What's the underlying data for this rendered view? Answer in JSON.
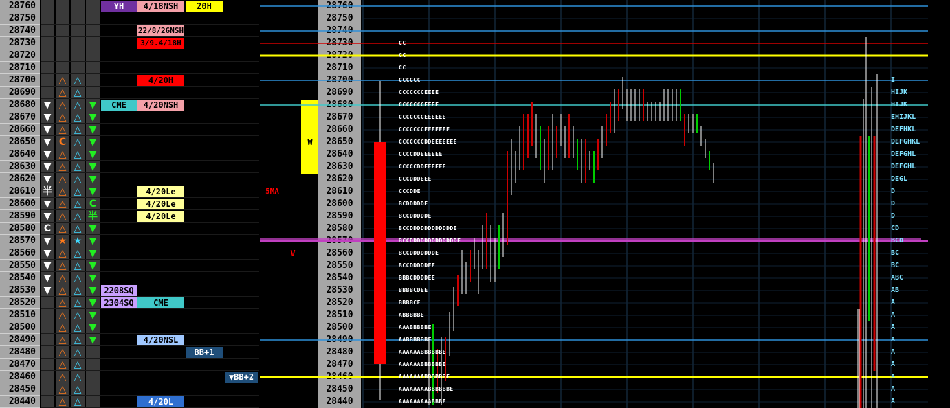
{
  "price_ladder": [
    "28760",
    "28750",
    "28740",
    "28730",
    "28720",
    "28710",
    "28700",
    "28690",
    "28680",
    "28670",
    "28660",
    "28650",
    "28640",
    "28630",
    "28620",
    "28610",
    "28600",
    "28590",
    "28580",
    "28570",
    "28560",
    "28550",
    "28540",
    "28530",
    "28520",
    "28510",
    "28500",
    "28490",
    "28480",
    "28470",
    "28460",
    "28450",
    "28440"
  ],
  "signal_rows": [
    {
      "price": "28680",
      "cols": [
        "tri-down",
        "tri-up-o",
        "tri-up-c",
        "tri-down-g"
      ]
    },
    {
      "price": "28670",
      "cols": [
        "tri-down",
        "tri-up-o",
        "tri-up-c",
        "tri-down-g"
      ]
    },
    {
      "price": "28660",
      "cols": [
        "tri-down",
        "tri-up-o",
        "tri-up-c",
        "tri-down-g"
      ]
    },
    {
      "price": "28650",
      "cols": [
        "tri-down",
        "C-o",
        "tri-up-c",
        "tri-down-g"
      ]
    },
    {
      "price": "28640",
      "cols": [
        "tri-down",
        "tri-up-o",
        "tri-up-c",
        "tri-down-g"
      ]
    },
    {
      "price": "28630",
      "cols": [
        "tri-down",
        "tri-up-o",
        "tri-up-c",
        "tri-down-g"
      ]
    },
    {
      "price": "28620",
      "cols": [
        "tri-down",
        "tri-up-o",
        "tri-up-c",
        "tri-down-g"
      ]
    },
    {
      "price": "28610",
      "cols": [
        "half-w",
        "tri-up-o",
        "tri-up-c",
        "tri-down-g"
      ]
    },
    {
      "price": "28600",
      "cols": [
        "tri-down",
        "tri-up-o",
        "tri-up-c",
        "C-g"
      ]
    },
    {
      "price": "28590",
      "cols": [
        "tri-down",
        "tri-up-o",
        "tri-up-c",
        "half-g"
      ]
    },
    {
      "price": "28580",
      "cols": [
        "C-w",
        "tri-up-o",
        "tri-up-c",
        "tri-down-g"
      ]
    },
    {
      "price": "28570",
      "cols": [
        "tri-down",
        "star-o",
        "star-c",
        "tri-down-g"
      ]
    },
    {
      "price": "28560",
      "cols": [
        "tri-down",
        "tri-up-o",
        "tri-up-c",
        "tri-down-g"
      ]
    },
    {
      "price": "28550",
      "cols": [
        "tri-down",
        "tri-up-o",
        "tri-up-c",
        "tri-down-g"
      ]
    },
    {
      "price": "28540",
      "cols": [
        "tri-down",
        "tri-up-o",
        "tri-up-c",
        "tri-down-g"
      ]
    },
    {
      "price": "28530",
      "cols": [
        "tri-down",
        "tri-up-o",
        "tri-up-c",
        "tri-down-g"
      ]
    },
    {
      "price": "28520",
      "cols": [
        "",
        "tri-up-o",
        "tri-up-c",
        "tri-down-g"
      ]
    },
    {
      "price": "28510",
      "cols": [
        "",
        "tri-up-o",
        "tri-up-c",
        "tri-down-g"
      ]
    },
    {
      "price": "28500",
      "cols": [
        "",
        "tri-up-o",
        "tri-up-c",
        "tri-down-g"
      ]
    },
    {
      "price": "28490",
      "cols": [
        "",
        "tri-up-o",
        "tri-up-c",
        "tri-down-g"
      ]
    },
    {
      "price": "28480",
      "cols": [
        "",
        "tri-up-o",
        "tri-up-c",
        ""
      ]
    },
    {
      "price": "28470",
      "cols": [
        "",
        "tri-up-o",
        "tri-up-c",
        ""
      ]
    },
    {
      "price": "28460",
      "cols": [
        "",
        "tri-up-o",
        "tri-up-c",
        ""
      ]
    },
    {
      "price": "28450",
      "cols": [
        "",
        "tri-up-o",
        "tri-up-c",
        ""
      ]
    },
    {
      "price": "28440",
      "cols": [
        "",
        "tri-up-o",
        "tri-up-c",
        ""
      ]
    },
    {
      "price": "28700",
      "cols": [
        "",
        "tri-up-o",
        "tri-up-c",
        ""
      ]
    },
    {
      "price": "28690",
      "cols": [
        "",
        "tri-up-o",
        "tri-up-c",
        ""
      ]
    }
  ],
  "labels": [
    {
      "text": "YH",
      "row": 0,
      "col": "A",
      "bg": "#7030a0",
      "fg": "#ffffff"
    },
    {
      "text": "4/18NSH",
      "row": 0,
      "col": "B",
      "bg": "#f4a0a8",
      "fg": "#000000"
    },
    {
      "text": "20H",
      "row": 0,
      "col": "C",
      "bg": "#ffff00",
      "fg": "#000000"
    },
    {
      "text": "22/8/26NSH",
      "row": 2,
      "col": "B",
      "bg": "#f4a0a8",
      "fg": "#000000"
    },
    {
      "text": "3/9.4/18H",
      "row": 3,
      "col": "B",
      "bg": "#ff0000",
      "fg": "#000000"
    },
    {
      "text": "4/20H",
      "row": 6,
      "col": "B",
      "bg": "#ff0000",
      "fg": "#000000"
    },
    {
      "text": "CME",
      "row": 8,
      "col": "A",
      "bg": "#40c8c8",
      "fg": "#000000"
    },
    {
      "text": "4/20NSH",
      "row": 8,
      "col": "B",
      "bg": "#f4a0a8",
      "fg": "#000000"
    },
    {
      "text": "4/20Le",
      "row": 15,
      "col": "B",
      "bg": "#ffff99",
      "fg": "#000000"
    },
    {
      "text": "4/20Le",
      "row": 16,
      "col": "B",
      "bg": "#ffff99",
      "fg": "#000000"
    },
    {
      "text": "4/20Le",
      "row": 17,
      "col": "B",
      "bg": "#ffff99",
      "fg": "#000000"
    },
    {
      "text": "2208SQ",
      "row": 23,
      "col": "A",
      "bg": "#c9a0ff",
      "fg": "#000000"
    },
    {
      "text": "2304SQ",
      "row": 24,
      "col": "A",
      "bg": "#c9a0ff",
      "fg": "#000000"
    },
    {
      "text": "CME",
      "row": 24,
      "col": "B",
      "bg": "#40c8c8",
      "fg": "#000000"
    },
    {
      "text": "4/20NSL",
      "row": 27,
      "col": "B",
      "bg": "#a0c8ff",
      "fg": "#000000"
    },
    {
      "text": "BB+1",
      "row": 28,
      "col": "C",
      "bg": "#1f4e79",
      "fg": "#ffffff"
    },
    {
      "text": "▼BB+2",
      "row": 30,
      "col": "D",
      "bg": "#1f4e79",
      "fg": "#ffffff"
    },
    {
      "text": "4/20L",
      "row": 32,
      "col": "B",
      "bg": "#2f6fd0",
      "fg": "#ffffff"
    }
  ],
  "mid_markers": {
    "w_label": "W",
    "sma_label": "5MA",
    "v_label": "V"
  },
  "tpo_profile": [
    "",
    "",
    "",
    "CC",
    "CC",
    "CC",
    "CCCCCC",
    "CCCCCCCEEEE",
    "CCCCCCCEEEE",
    "CCCCCCCEEEEEE",
    "CCCCCCCEEEEEEE",
    "CCCCCCCDDEEEEEEE",
    "CCCCDDEEEEEE",
    "CCCCCDDEEEEEE",
    "CCCDDDEEE",
    "CCCDDE",
    "BCDDDDDE",
    "BCCDDDDDE",
    "BCCDDDDDDDDDDDDE",
    "BCCDDDDDDDDDDDDDE",
    "BCCDDDDDDDE",
    "BCCDDDDDEE",
    "BBBCDDDDEE",
    "BBBBCDEE",
    "BBBBCE",
    "ABBBBBE",
    "AAABBBBBE",
    "AABBBBBBE",
    "AAAAAABBBBBBE",
    "AAAAAABBBBBBE",
    "AAAAAAABBBBBBE",
    "AAAAAAAABBBBBBE",
    "AAAAAAAAABBBE"
  ],
  "right_labels": [
    "",
    "",
    "",
    "",
    "",
    "",
    "I",
    "HIJK",
    "HIJK",
    "EHIJKL",
    "DEFHKL",
    "DEFGHKL",
    "DEFGHL",
    "DEFGHL",
    "DEGL",
    "D",
    "D",
    "D",
    "CD",
    "BCD",
    "BC",
    "BC",
    "ABC",
    "AB",
    "A",
    "A",
    "A",
    "A",
    "A",
    "A",
    "A",
    "A",
    "A"
  ],
  "colors": {
    "up": "#ffffff",
    "down": "#cc0000",
    "ma": "#22aa22",
    "blue_line": "#2e8fd8",
    "red_line": "#d00000",
    "yellow_line": "#ffff00",
    "magenta_line": "#c040c0",
    "teal_line": "#40c8c8"
  },
  "horizontal_levels": [
    {
      "price": "28760",
      "color": "blue"
    },
    {
      "price": "28740",
      "color": "blue"
    },
    {
      "price": "28730",
      "color": "red"
    },
    {
      "price": "28720",
      "color": "yellow"
    },
    {
      "price": "28700",
      "color": "blue"
    },
    {
      "price": "28680",
      "color": "teal"
    },
    {
      "price": "28570",
      "color": "magenta"
    },
    {
      "price": "28490",
      "color": "blue"
    },
    {
      "price": "28460",
      "color": "yellow"
    }
  ]
}
